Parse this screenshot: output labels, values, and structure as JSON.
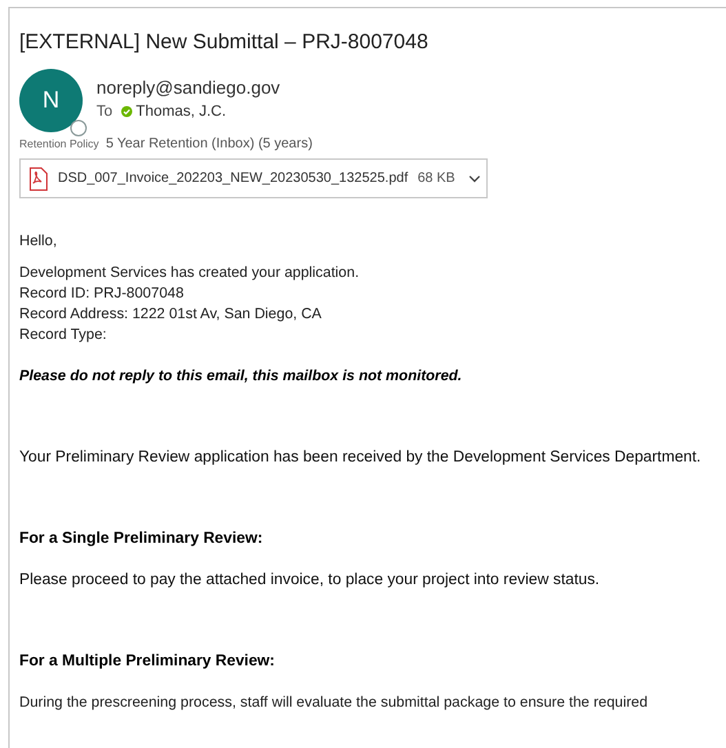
{
  "subject": "[EXTERNAL] New Submittal – PRJ-8007048",
  "sender": {
    "initial": "N",
    "address": "noreply@sandiego.gov",
    "to_label": "To",
    "recipient": "Thomas, J.C."
  },
  "retention": {
    "label": "Retention Policy",
    "value": "5 Year Retention (Inbox) (5 years)"
  },
  "attachment": {
    "name": "DSD_007_Invoice_202203_NEW_20230530_132525.pdf",
    "size": "68 KB"
  },
  "body": [
    {
      "kind": "text",
      "lines": [
        "Hello,"
      ]
    },
    {
      "kind": "text",
      "lines": [
        "Development Services has created your application.",
        "Record ID: PRJ-8007048",
        "Record Address: 1222 01st Av, San Diego, CA",
        "Record Type:"
      ]
    },
    {
      "kind": "notice",
      "lines": [
        "Please do not reply to this email, this mailbox is not monitored."
      ]
    },
    {
      "kind": "arial",
      "lines": [
        "Your Preliminary Review application has been received by the Development Services Department."
      ]
    },
    {
      "kind": "heading",
      "lines": [
        "For a Single Preliminary Review:"
      ]
    },
    {
      "kind": "arial",
      "lines": [
        "Please proceed to pay the attached invoice, to place your project into review status."
      ]
    },
    {
      "kind": "heading",
      "lines": [
        "For a Multiple Preliminary Review:"
      ]
    },
    {
      "kind": "text",
      "lines": [
        "During the prescreening process, staff will evaluate the submittal package to ensure the required"
      ]
    }
  ]
}
